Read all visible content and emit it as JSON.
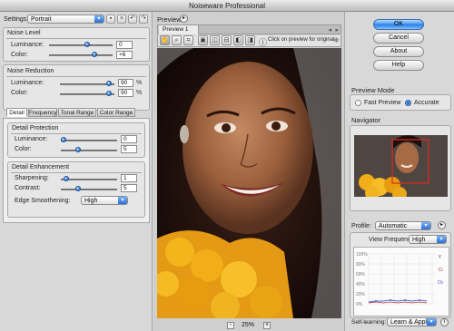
{
  "window": {
    "title": "Noiseware Professional"
  },
  "settings": {
    "label": "Settings:",
    "value": "Portrait"
  },
  "noise_level": {
    "title": "Noise Level",
    "luminance": {
      "label": "Luminance:",
      "value": "0"
    },
    "color": {
      "label": "Color:",
      "value": "+6"
    }
  },
  "noise_reduction": {
    "title": "Noise Reduction",
    "luminance": {
      "label": "Luminance:",
      "value": "90",
      "unit": "%"
    },
    "color": {
      "label": "Color:",
      "value": "90",
      "unit": "%"
    }
  },
  "tabs": [
    {
      "label": "Detail"
    },
    {
      "label": "Frequency"
    },
    {
      "label": "Tonal Range"
    },
    {
      "label": "Color Range"
    }
  ],
  "detail_protection": {
    "title": "Detail Protection",
    "luminance": {
      "label": "Luminance:",
      "value": "0"
    },
    "color": {
      "label": "Color:",
      "value": "5"
    }
  },
  "detail_enhancement": {
    "title": "Detail Enhancement",
    "sharpening": {
      "label": "Sharpening:",
      "value": "1"
    },
    "contrast": {
      "label": "Contrast:",
      "value": "5"
    },
    "edge_smoothening": {
      "label": "Edge Smoothening:",
      "value": "High"
    }
  },
  "preview": {
    "title": "Preview",
    "tab": "Preview 1",
    "hint": "Click on preview for original",
    "zoom": "25%",
    "zoom_out": "-",
    "zoom_in": "+"
  },
  "buttons": {
    "ok": "OK",
    "cancel": "Cancel",
    "about": "About",
    "help": "Help"
  },
  "preview_mode": {
    "title": "Preview Mode",
    "fast": "Fast Preview",
    "accurate": "Accurate",
    "selected": "Accurate"
  },
  "navigator": {
    "title": "Navigator"
  },
  "profile": {
    "label": "Profile:",
    "value": "Automatic",
    "view_frequency_label": "View Frequency:",
    "view_frequency_value": "High",
    "y_ticks": [
      "100%",
      "80%",
      "60%",
      "40%",
      "20%",
      "0%"
    ],
    "legend": [
      "Y",
      "Cr",
      "Cb"
    ],
    "self_learning_label": "Self-learning:",
    "self_learning_value": "Learn & Apply"
  },
  "colors": {
    "accent": "#2f7be3",
    "knob": "#3a7fd8",
    "bg": "#d6d6d6"
  }
}
